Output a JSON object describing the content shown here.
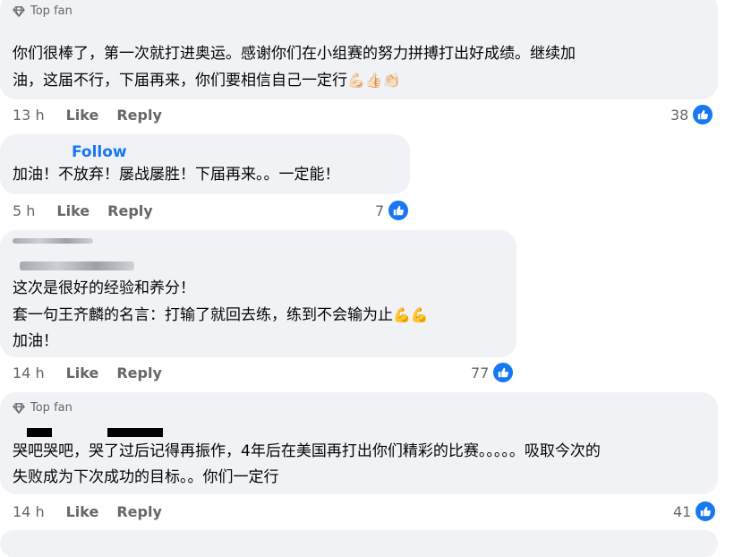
{
  "comments": [
    {
      "badge": "Top fan",
      "text_lines": [
        "你们很棒了，第一次就打进奥运。感谢你们在小组赛的努力拼搏打出好成绩。继续加",
        "油，这届不行，下届再来，你们要相信自己一定行"
      ],
      "emojis": "💪🏻👍🏻👏🏻",
      "time": "13 h",
      "like_label": "Like",
      "reply_label": "Reply",
      "reactions": "38"
    },
    {
      "follow_label": "Follow",
      "text_lines": [
        "加油！不放弃！屡战屡胜！下届再来。。一定能！"
      ],
      "time": "5 h",
      "like_label": "Like",
      "reply_label": "Reply",
      "reactions": "7"
    },
    {
      "text_lines": [
        "这次是很好的经验和养分！",
        "套一句王齐麟的名言：打输了就回去练，练到不会输为止",
        "加油！"
      ],
      "emojis": "💪💪",
      "time": "14 h",
      "like_label": "Like",
      "reply_label": "Reply",
      "reactions": "77"
    },
    {
      "badge": "Top fan",
      "text_lines": [
        "哭吧哭吧，哭了过后记得再振作，4年后在美国再打出你们精彩的比赛。。。。。吸取今次的",
        "失败成为下次成功的目标。。你们一定行"
      ],
      "time": "14 h",
      "like_label": "Like",
      "reply_label": "Reply",
      "reactions": "41"
    }
  ],
  "colors": {
    "bubble": "#f0f2f5",
    "link": "#1877f2",
    "meta": "#65676b",
    "like": "#1877f2"
  },
  "icons": {
    "badge": "diamond-icon",
    "reaction": "thumbs-up-icon"
  }
}
